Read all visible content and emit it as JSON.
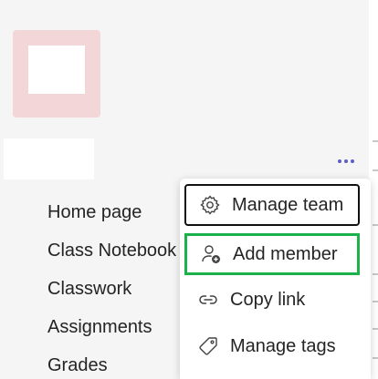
{
  "team": {
    "avatar_color": "#f3d6d8"
  },
  "nav": {
    "items": [
      {
        "label": "Home page"
      },
      {
        "label": "Class Notebook"
      },
      {
        "label": "Classwork"
      },
      {
        "label": "Assignments"
      },
      {
        "label": "Grades"
      }
    ]
  },
  "more_button": {
    "icon": "more-horizontal-icon",
    "color": "#5b5fc7"
  },
  "menu": {
    "items": [
      {
        "label": "Manage team",
        "icon": "gear-icon"
      },
      {
        "label": "Add member",
        "icon": "person-add-icon"
      },
      {
        "label": "Copy link",
        "icon": "link-icon"
      },
      {
        "label": "Manage tags",
        "icon": "tag-icon"
      }
    ],
    "focus_outline_color": "#111111",
    "highlight_outline_color": "#1db14b"
  }
}
